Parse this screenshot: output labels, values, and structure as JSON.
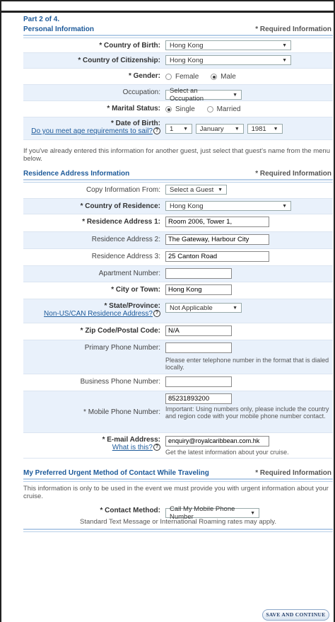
{
  "part": "Part 2 of 4.",
  "personal": {
    "title": "Personal Information",
    "required": "* Required Information"
  },
  "birth": {
    "label": "* Country of Birth:",
    "value": "Hong Kong"
  },
  "citizen": {
    "label": "* Country of Citizenship:",
    "value": "Hong Kong"
  },
  "gender": {
    "label": "* Gender:",
    "options": [
      "Female",
      "Male"
    ],
    "selected": "Male"
  },
  "occupation": {
    "label": "Occupation:",
    "value": "Select an Occupation"
  },
  "marital": {
    "label": "* Marital Status:",
    "options": [
      "Single",
      "Married"
    ],
    "selected": "Single"
  },
  "dob": {
    "label": "* Date of Birth:",
    "link": "Do you meet age requirements to sail?",
    "day": "1",
    "month": "January",
    "year": "1981"
  },
  "copy_note": "If you've already entered this information for another guest, just select that guest's name from the menu below.",
  "residence": {
    "title": "Residence Address Information",
    "required": "* Required Information"
  },
  "copyfrom": {
    "label": "Copy Information From:",
    "value": "Select a Guest"
  },
  "country_res": {
    "label": "* Country of Residence:",
    "value": "Hong Kong"
  },
  "addr1": {
    "label": "* Residence Address 1:",
    "value": "Room 2006, Tower 1,"
  },
  "addr2": {
    "label": "Residence Address 2:",
    "value": "The Gateway, Harbour City"
  },
  "addr3": {
    "label": "Residence Address 3:",
    "value": "25 Canton Road"
  },
  "apt": {
    "label": "Apartment Number:",
    "value": ""
  },
  "city": {
    "label": "* City or Town:",
    "value": "Hong Kong"
  },
  "state": {
    "label": "* State/Province:",
    "link": "Non-US/CAN Residence Address?",
    "value": "Not Applicable"
  },
  "zip": {
    "label": "* Zip Code/Postal Code:",
    "value": "N/A"
  },
  "primary": {
    "label": "Primary Phone Number:",
    "value": "",
    "note": "Please enter telephone number in the format that is dialed locally."
  },
  "business": {
    "label": "Business Phone Number:",
    "value": ""
  },
  "mobile": {
    "label": "* Mobile Phone Number:",
    "value": "85231893200",
    "note": "Important: Using numbers only, please include the country and region code with your mobile phone number contact."
  },
  "email": {
    "label": "* E-mail Address:",
    "link": "What is this?",
    "value": "enquiry@royalcaribbean.com.hk",
    "note": "Get the latest information about your cruise."
  },
  "urgent": {
    "title": "My Preferred Urgent Method of Contact While Traveling",
    "required": "* Required Information"
  },
  "urgent_note": "This information is only to be used in the event we must provide you with urgent information about your cruise.",
  "contact": {
    "label": "* Contact Method:",
    "value": "Call My Mobile Phone Number"
  },
  "rates_note": "Standard Text Message or International Roaming rates may apply.",
  "button": "SAVE AND CONTINUE",
  "help_icon": "question-icon"
}
